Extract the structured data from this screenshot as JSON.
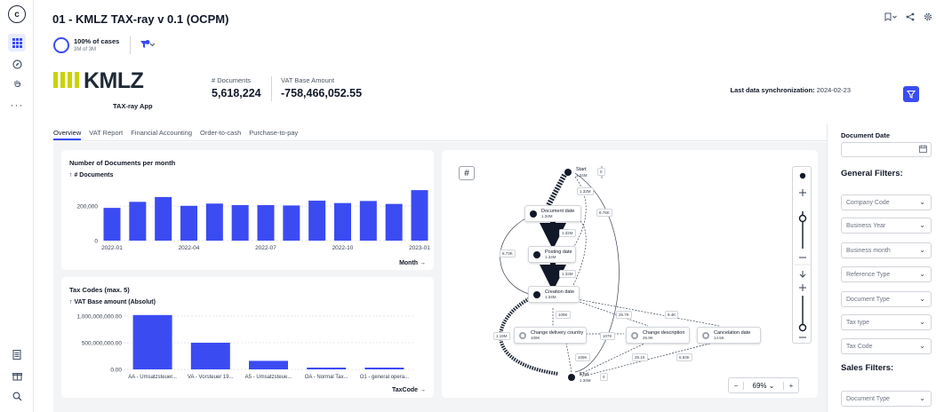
{
  "app": {
    "title": "01 - KMLZ TAX-ray v 0.1 (OCPM)",
    "logo_letter": "c",
    "accent_color": "#3b4bf2"
  },
  "rail": {
    "icons": [
      "celonis-logo-icon",
      "grid-icon",
      "compass-icon",
      "hand-icon",
      "more-icon",
      "document-icon",
      "gift-icon",
      "search-icon"
    ]
  },
  "cases": {
    "percent_label": "100% of cases",
    "count_label": "3M of 3M"
  },
  "brand": {
    "word": "KMLZ",
    "subtitle": "TAX-ray App"
  },
  "kpis": [
    {
      "label": "# Documents",
      "value": "5,618,224"
    },
    {
      "label": "VAT Base Amount",
      "value": "-758,466,052.55"
    }
  ],
  "sync": {
    "label": "Last data synchronization:",
    "value": "2024-02-23"
  },
  "tabs": [
    "Overview",
    "VAT Report",
    "Financial Accounting",
    "Order-to-cash",
    "Purchase-to-pay"
  ],
  "active_tab": "Overview",
  "charts": {
    "docs_title": "Number of Documents per month",
    "docs_sub": "↑ # Documents",
    "docs_foot": "Month →",
    "tax_title": "Tax Codes (max. 5)",
    "tax_sub": "↑ VAT Base amount (Absolut)",
    "tax_foot": "TaxCode →"
  },
  "chart_data": [
    {
      "type": "bar",
      "title": "Number of Documents per month",
      "ylabel": "# Documents",
      "xlabel": "Month",
      "x_tick_labels": [
        "2022-01",
        "2022-04",
        "2022-07",
        "2022-10",
        "2023-01"
      ],
      "y_tick_labels": [
        "200,000",
        "0"
      ],
      "ylim": [
        0,
        340000
      ],
      "categories": [
        "2022-01",
        "2022-02",
        "2022-03",
        "2022-04",
        "2022-05",
        "2022-06",
        "2022-07",
        "2022-08",
        "2022-09",
        "2022-10",
        "2022-11",
        "2022-12",
        "2023-01"
      ],
      "values": [
        190000,
        225000,
        253000,
        202000,
        215000,
        206000,
        206000,
        204000,
        232000,
        218000,
        230000,
        213000,
        293000
      ],
      "bar_color": "#3b4bf2",
      "grid": true
    },
    {
      "type": "bar",
      "title": "Tax Codes (max. 5)",
      "ylabel": "VAT Base amount (Absolut)",
      "xlabel": "TaxCode",
      "categories": [
        "AA - Umsatzsteuer...",
        "VA - Vorsteuer 19...",
        "A5 - Umsatzsteue...",
        "OA - Normal Tax...",
        "O1 - general opera..."
      ],
      "y_tick_labels": [
        "1,000,000,000.00",
        "500,000,000.00",
        "0.00"
      ],
      "ylim": [
        0,
        1100000000
      ],
      "values": [
        1020000000,
        500000000,
        160000000,
        30000000,
        25000000
      ],
      "bar_color": "#3b4bf2",
      "grid": true
    }
  ],
  "process_map": {
    "nodes": [
      {
        "name": "Start",
        "count": "1.34M"
      },
      {
        "name": "Document date",
        "count": "1.34M"
      },
      {
        "name": "Posting date",
        "count": "1.34M"
      },
      {
        "name": "Creation date",
        "count": "1.34M"
      },
      {
        "name": "Change delivery country",
        "count": "109K"
      },
      {
        "name": "Change description",
        "count": "26.9K"
      },
      {
        "name": "Cancelation date",
        "count": "14.5K"
      },
      {
        "name": "End",
        "count": "1.34M"
      }
    ],
    "edge_labels": [
      "1.32M",
      "8.76K",
      "1.32M",
      "8.73K",
      "1.32M",
      "109K",
      "25.7K",
      "8.4K",
      "1.19M",
      "107K",
      "109K",
      "25.1K",
      "6.93K"
    ],
    "start_badge": "0",
    "end_badge": "0",
    "zoom": "69%",
    "zoom_minus": "−",
    "zoom_plus": "+"
  },
  "filters": {
    "date_label": "Document Date",
    "general_heading": "General Filters:",
    "general": [
      "Company Code",
      "Business Year",
      "Business month",
      "Reference Type",
      "Document Type",
      "Tax type",
      "Tax Code"
    ],
    "sales_heading": "Sales Filters:",
    "sales": [
      "Document Type"
    ]
  }
}
